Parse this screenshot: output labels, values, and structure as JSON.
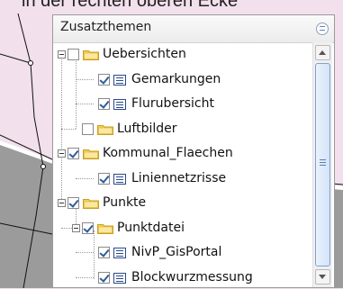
{
  "top_text": "in der rechten oberen Ecke",
  "panel": {
    "title": "Zusatzthemen",
    "collapse_icon": "collapse-icon"
  },
  "tree": [
    {
      "label": "Uebersichten",
      "type": "folder",
      "checked": false,
      "expanded": true
    },
    {
      "label": "Gemarkungen",
      "type": "layer",
      "checked": true
    },
    {
      "label": "Flurubersicht",
      "type": "layer",
      "checked": true
    },
    {
      "label": "Luftbilder",
      "type": "folder",
      "checked": false,
      "expanded": false
    },
    {
      "label": "Kommunal_Flaechen",
      "type": "folder",
      "checked": true,
      "expanded": true
    },
    {
      "label": "Liniennetzrisse",
      "type": "layer",
      "checked": true
    },
    {
      "label": "Punkte",
      "type": "folder",
      "checked": true,
      "expanded": true
    },
    {
      "label": "Punktdatei",
      "type": "folder",
      "checked": true,
      "expanded": true
    },
    {
      "label": "NivP_GisPortal",
      "type": "layer",
      "checked": true
    },
    {
      "label": "Blockwurzmessung",
      "type": "layer",
      "checked": true
    }
  ],
  "colors": {
    "map_pink": "#f2e0ec",
    "map_gray": "#9a9a9a",
    "folder_yellow": "#f5d24a",
    "scroll_accent": "#7da2ce"
  }
}
